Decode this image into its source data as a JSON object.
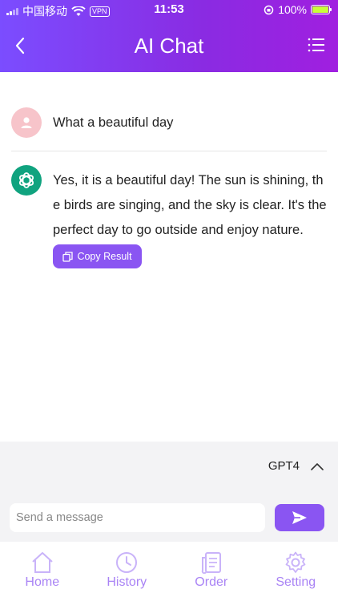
{
  "status_bar": {
    "carrier": "中国移动",
    "vpn": "VPN",
    "time": "11:53",
    "battery": "100%"
  },
  "header": {
    "title": "AI Chat",
    "back_icon": "chevron-left-icon",
    "menu_icon": "list-icon"
  },
  "conversation": {
    "user_message": "What a beautiful day",
    "ai_message": "Yes, it is a beautiful day! The sun is shining, the birds are singing, and the sky is clear. It's the perfect day to go outside and enjoy nature.",
    "copy_label": "Copy Result"
  },
  "composer": {
    "model": "GPT4",
    "placeholder": "Send a message"
  },
  "tabs": [
    {
      "label": "Home",
      "icon": "home-icon"
    },
    {
      "label": "History",
      "icon": "clock-icon"
    },
    {
      "label": "Order",
      "icon": "document-icon"
    },
    {
      "label": "Setting",
      "icon": "gear-icon"
    }
  ],
  "colors": {
    "accent": "#8a55f2",
    "header_start": "#7b4dff",
    "header_end": "#a01fe0",
    "ai_avatar": "#10a37f",
    "user_avatar": "#f7c4ca",
    "tab_inactive": "#a983f5"
  }
}
